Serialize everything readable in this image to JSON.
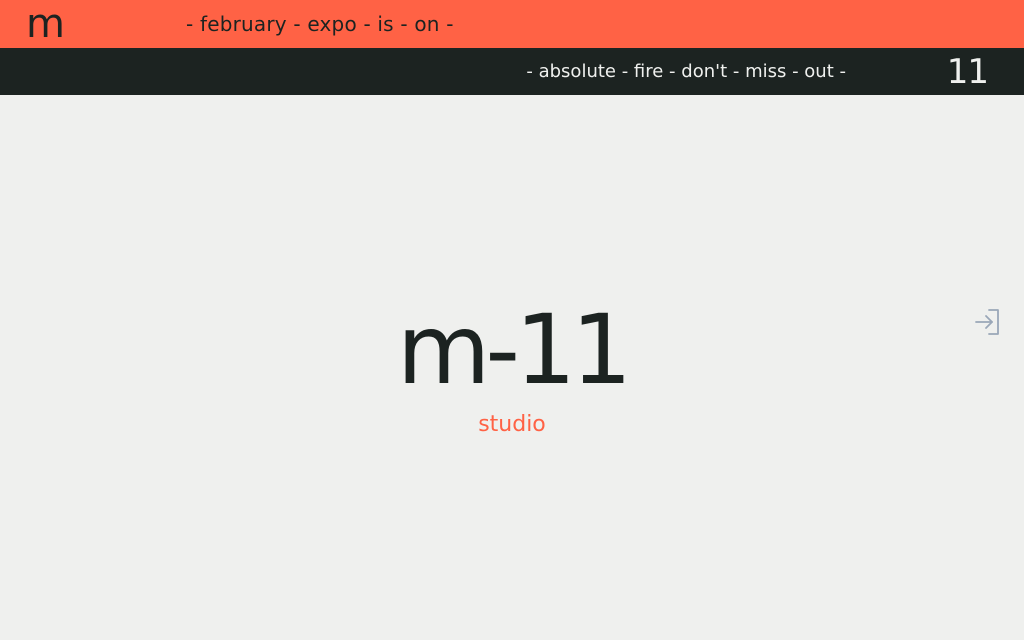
{
  "header": {
    "logo": "m",
    "marquee_top": "- february - expo - is - on -",
    "marquee_bottom": "- absolute - fire - don't - miss - out -",
    "count": "11"
  },
  "hero": {
    "title": "m-11",
    "subtitle": "studio"
  },
  "actions": {
    "login_icon": "login-arrow-icon"
  },
  "colors": {
    "accent": "#ff6245",
    "dark": "#1c2321",
    "background": "#eff0ee",
    "icon": "#9aa7b8"
  }
}
